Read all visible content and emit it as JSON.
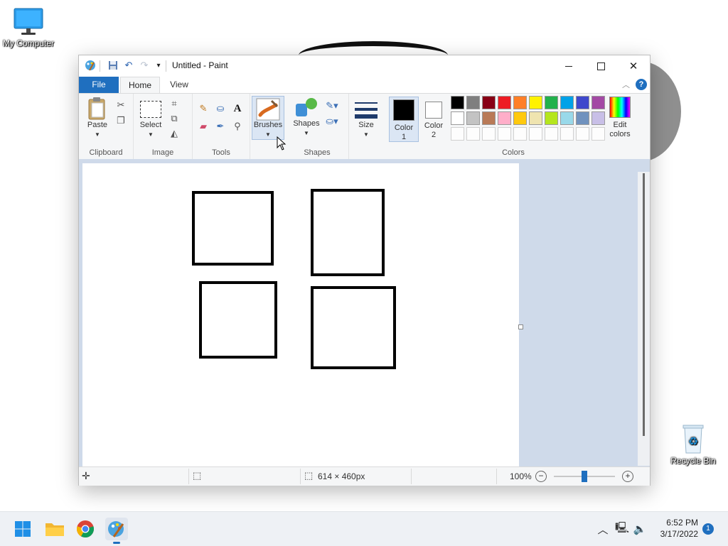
{
  "desktop": {
    "icons": [
      {
        "label": "My Computer"
      },
      {
        "label": "Recycle Bin"
      }
    ]
  },
  "window": {
    "title": "Untitled - Paint",
    "tabs": {
      "file": "File",
      "home": "Home",
      "view": "View"
    },
    "ribbon": {
      "clipboard": {
        "paste": "Paste",
        "group_label": "Clipboard"
      },
      "image": {
        "select": "Select",
        "group_label": "Image"
      },
      "tools": {
        "group_label": "Tools"
      },
      "brushes": {
        "label": "Brushes"
      },
      "shapes": {
        "label": "Shapes",
        "group_label": "Shapes"
      },
      "size": {
        "label": "Size"
      },
      "colors": {
        "color1_line1": "Color",
        "color1_line2": "1",
        "color2_line1": "Color",
        "color2_line2": "2",
        "edit_line1": "Edit",
        "edit_line2": "colors",
        "group_label": "Colors",
        "color1": "#000000",
        "color2": "#ffffff",
        "palette_row1": [
          "#000000",
          "#7f7f7f",
          "#880015",
          "#ed1c24",
          "#ff7f27",
          "#fff200",
          "#22b14c",
          "#00a2e8",
          "#3f48cc",
          "#a349a4"
        ],
        "palette_row2": [
          "#ffffff",
          "#c3c3c3",
          "#b97a57",
          "#ffaec9",
          "#ffc90e",
          "#efe4b0",
          "#b5e61d",
          "#99d9ea",
          "#7092be",
          "#c8bfe7"
        ]
      }
    },
    "status": {
      "dimensions": "614 × 460px",
      "zoom": "100%",
      "zoom_fraction": 0.5
    }
  },
  "taskbar": {
    "time": "6:52 PM",
    "date": "3/17/2022",
    "notification_count": "1"
  },
  "colors": {
    "accent": "#1f6fbf",
    "canvas_bg": "#cfdaea"
  }
}
